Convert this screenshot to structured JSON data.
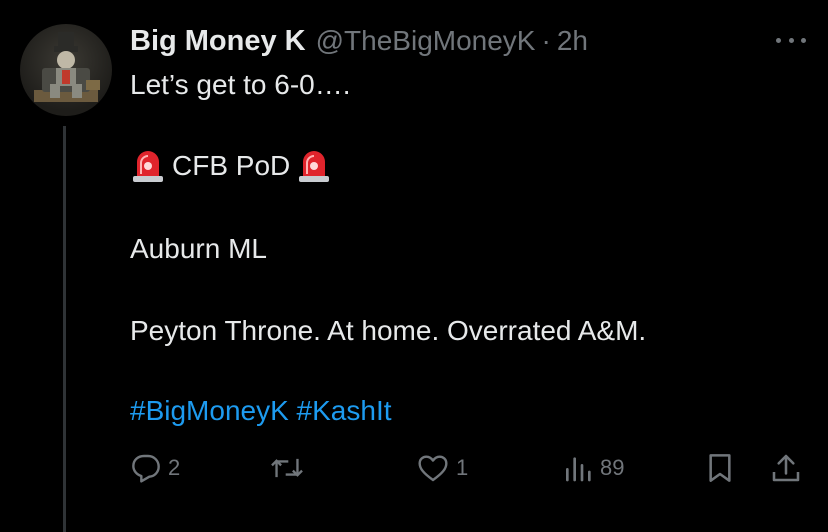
{
  "tweet": {
    "display_name": "Big Money K",
    "handle": "@TheBigMoneyK",
    "separator": "·",
    "time": "2h",
    "body": {
      "line1": "Let’s get to 6-0….",
      "line2_text": "CFB PoD",
      "line3": "Auburn ML",
      "line4": "Peyton Throne. At home. Overrated A&M.",
      "hashtags": [
        "#BigMoneyK",
        "#KashIt"
      ]
    },
    "stats": {
      "replies": "2",
      "likes": "1",
      "views": "89"
    }
  },
  "icons": {
    "siren": "police-car-light-emoji",
    "reply": "reply-icon",
    "retweet": "retweet-icon",
    "like": "heart-icon",
    "views": "views-chart-icon",
    "bookmark": "bookmark-icon",
    "share": "share-icon",
    "more": "more-dots-icon"
  },
  "colors": {
    "background": "#000000",
    "text": "#e7e9ea",
    "muted": "#71767b",
    "link": "#1d9bf0",
    "thread_line": "#2f3336"
  }
}
